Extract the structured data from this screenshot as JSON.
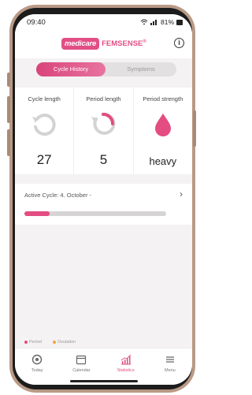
{
  "status_bar": {
    "time": "09:40",
    "battery": "81%"
  },
  "header": {
    "brand_badge": "medicare",
    "brand_name": "FEMSENSE",
    "registered": "®"
  },
  "segmented": {
    "active_tab": "Cycle History",
    "inactive_tab": "Symptoms"
  },
  "stats": [
    {
      "label": "Cycle length",
      "value": "27",
      "icon": "cycle-refresh-icon"
    },
    {
      "label": "Period length",
      "value": "5",
      "icon": "period-progress-icon"
    },
    {
      "label": "Period strength",
      "value": "heavy",
      "icon": "drop-icon"
    }
  ],
  "active_cycle": {
    "label": "Active Cycle: 4. October -",
    "progress_fraction": 0.18
  },
  "legend": {
    "period": "Period",
    "ovulation": "Ovulation"
  },
  "tabbar": [
    {
      "label": "Today",
      "icon": "today-icon"
    },
    {
      "label": "Calendar",
      "icon": "calendar-icon"
    },
    {
      "label": "Statistics",
      "icon": "statistics-icon",
      "active": true
    },
    {
      "label": "Menu",
      "icon": "menu-icon"
    }
  ],
  "colors": {
    "accent": "#e34d82",
    "gray_icon": "#d3d3d3",
    "track": "#d6d4d5"
  }
}
